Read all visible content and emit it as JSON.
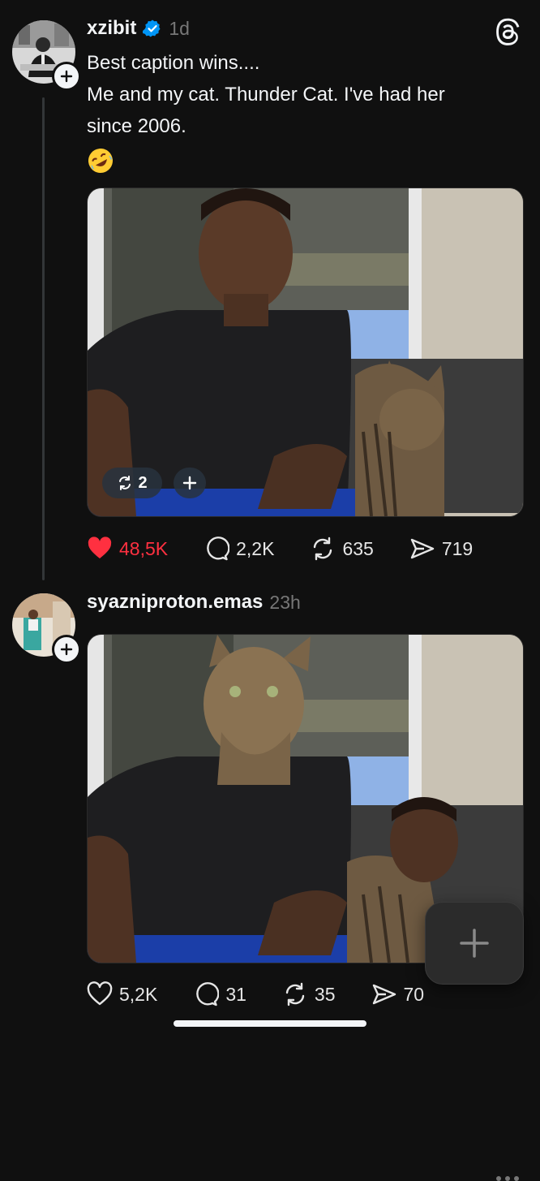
{
  "post1": {
    "username": "xzibit",
    "time": "1d",
    "caption": "Best caption wins....\nMe and my cat. Thunder Cat. I've had her\nsince 2006.",
    "emoji": "rolling-on-floor-laughing",
    "repost_count": "2",
    "likes": "48,5K",
    "comments": "2,2K",
    "reposts": "635",
    "shares": "719",
    "liked": true
  },
  "post2": {
    "username": "syazniproton.emas",
    "time": "23h",
    "likes": "5,2K",
    "comments": "31",
    "reposts": "35",
    "shares": "70"
  },
  "colors": {
    "background": "#101010",
    "text": "#f3f5f7",
    "muted": "#777777",
    "like_red": "#ff3040",
    "verified_blue": "#0095f6"
  },
  "icons": {
    "header": "threads-logo-icon",
    "like": "heart-icon",
    "comment": "comment-bubble-icon",
    "repost": "repost-icon",
    "share": "send-icon",
    "compose": "plus-icon",
    "more": "more-dots-icon"
  }
}
